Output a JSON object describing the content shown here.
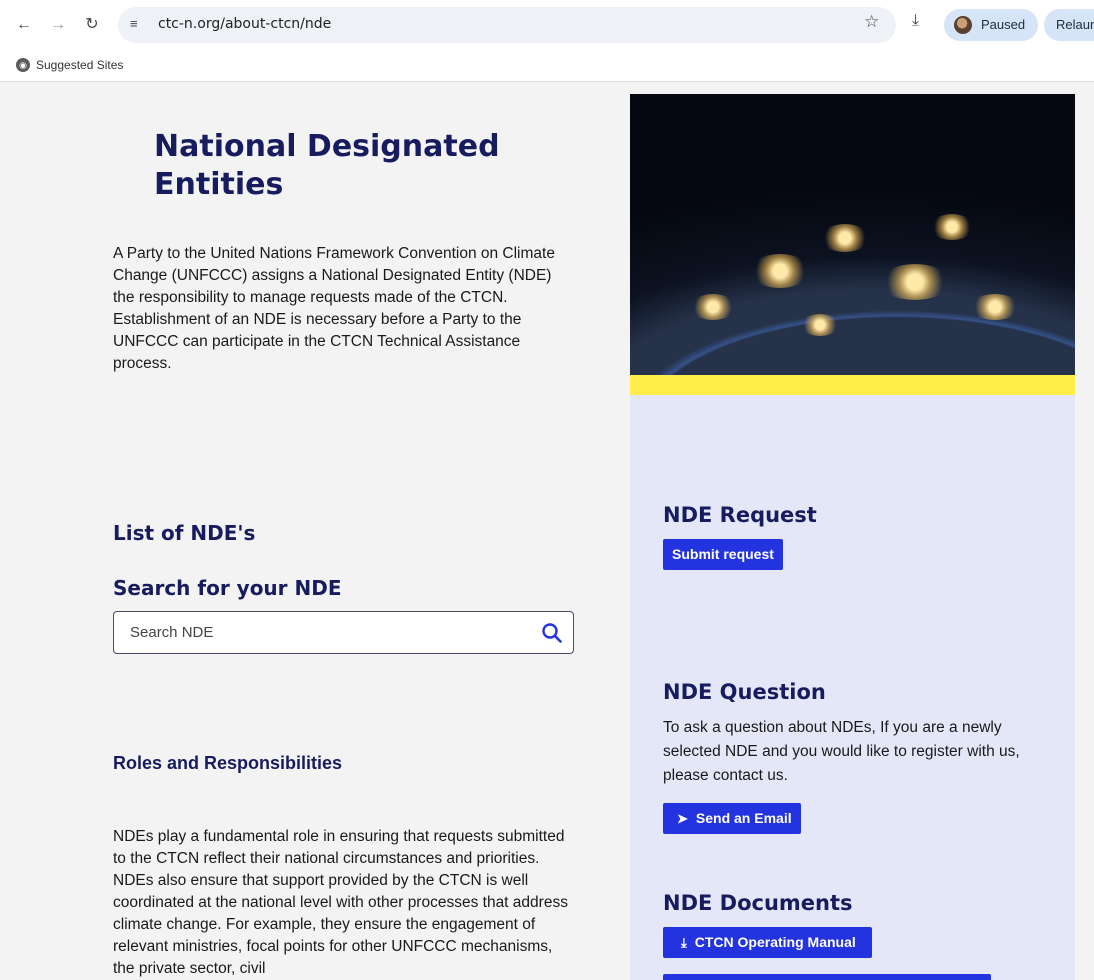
{
  "browser": {
    "url": "ctc-n.org/about-ctcn/nde",
    "profile_status": "Paused",
    "relaunch_label": "Relaunch",
    "bookmark": "Suggested Sites"
  },
  "main": {
    "title": "National Designated Entities",
    "intro": "A Party to the United Nations Framework Convention on Climate Change (UNFCCC) assigns a National Designated Entity (NDE) the responsibility to manage requests made of the CTCN. Establishment of an NDE is necessary before a Party to the UNFCCC can participate in the CTCN Technical Assistance process.",
    "list_heading": "List of NDE's",
    "search_heading": "Search for your NDE",
    "search_placeholder": "Search NDE",
    "roles_heading": "Roles and Responsibilities",
    "roles_text": "NDEs play a fundamental role in ensuring that requests submitted to the CTCN reflect their national circumstances and priorities. NDEs also ensure that support provided by the CTCN is well coordinated at the national level with other processes that address climate change. For example, they ensure the engagement of relevant ministries, focal points for other UNFCCC mechanisms, the private sector, civil"
  },
  "sidebar": {
    "request_heading": "NDE Request",
    "request_button": "Submit request",
    "question_heading": "NDE Question",
    "question_text": "To ask a question about NDEs, If you are a newly selected NDE and you would like to register with us, please contact us.",
    "email_button": "Send an Email",
    "documents_heading": "NDE Documents",
    "manual_button": "CTCN Operating Manual"
  },
  "colors": {
    "heading": "#161c5e",
    "button": "#2433e0",
    "sidebar_bg": "#e4e7f8",
    "accent_bar": "#ffed4a"
  }
}
